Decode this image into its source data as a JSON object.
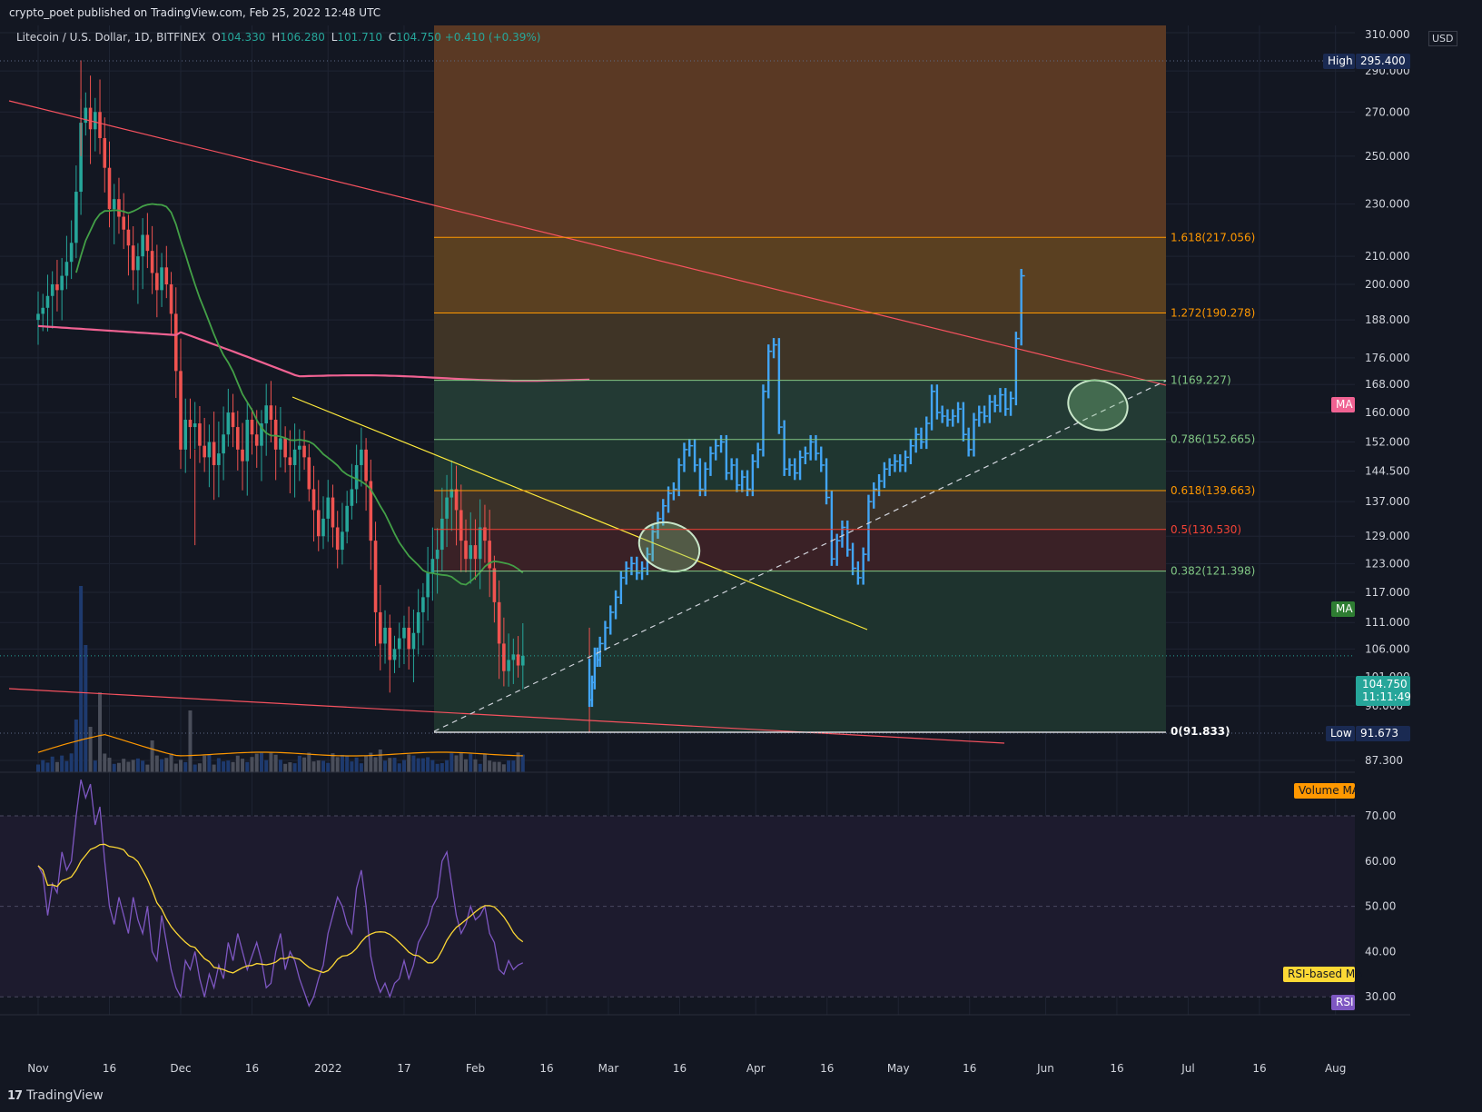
{
  "header": {
    "published": "crypto_poet published on TradingView.com, Feb 25, 2022 12:48 UTC"
  },
  "legend": {
    "symbol": "Litecoin / U.S. Dollar, 1D, BITFINEX",
    "open_label": "O",
    "open": "104.330",
    "high_label": "H",
    "high": "106.280",
    "low_label": "L",
    "low": "101.710",
    "close_label": "C",
    "close": "104.750",
    "change": "+0.410 (+0.39%)"
  },
  "currency": "USD",
  "colors": {
    "background": "#131722",
    "up_candle": "#26a69a",
    "down_candle": "#ef5350",
    "projection": "#42a5f5",
    "ma_fast": "#43a047",
    "ma_slow": "#f06292",
    "trend_red": "#f7525f",
    "trend_yellow": "#ffeb3b",
    "rsi": "#7e57c2",
    "rsi_ma": "#fdd835",
    "volume_ma": "#ff9800"
  },
  "price_axis": {
    "ticks": [
      "310.000",
      "290.000",
      "270.000",
      "250.000",
      "230.000",
      "210.000",
      "200.000",
      "188.000",
      "176.000",
      "168.000",
      "160.000",
      "152.000",
      "144.500",
      "137.000",
      "129.000",
      "123.000",
      "117.000",
      "111.000",
      "106.000",
      "101.000",
      "96.000",
      "87.300"
    ],
    "high_tag": {
      "label": "High",
      "value": "295.400"
    },
    "low_tag": {
      "label": "Low",
      "value": "91.673"
    },
    "last_price": {
      "value": "104.750",
      "countdown": "11:11:49"
    },
    "ma_tag_pink": "MA",
    "ma_tag_green": "MA",
    "volume_ma_tag": "Volume MA"
  },
  "fib_levels": [
    {
      "label": "1.618(217.056)",
      "value": 217.056,
      "color": "#ff9800"
    },
    {
      "label": "1.272(190.278)",
      "value": 190.278,
      "color": "#ff9800"
    },
    {
      "label": "1(169.227)",
      "value": 169.227,
      "color": "#81c784"
    },
    {
      "label": "0.786(152.665)",
      "value": 152.665,
      "color": "#81c784"
    },
    {
      "label": "0.618(139.663)",
      "value": 139.663,
      "color": "#ff9800"
    },
    {
      "label": "0.5(130.530)",
      "value": 130.53,
      "color": "#f44336"
    },
    {
      "label": "0.382(121.398)",
      "value": 121.398,
      "color": "#81c784"
    },
    {
      "label": "0(91.833)",
      "value": 91.833,
      "color": "#ffffff"
    }
  ],
  "rsi_axis": {
    "ticks": [
      "70.00",
      "60.00",
      "50.00",
      "40.00",
      "30.00"
    ],
    "rsi_ma_tag": "RSI-based MA",
    "rsi_tag": "RSI"
  },
  "time_axis": [
    "Nov",
    "16",
    "Dec",
    "16",
    "2022",
    "17",
    "Feb",
    "16",
    "Mar",
    "16",
    "Apr",
    "16",
    "May",
    "16",
    "Jun",
    "16",
    "Jul",
    "16",
    "Aug"
  ],
  "footer": {
    "brand": "TradingView"
  }
}
